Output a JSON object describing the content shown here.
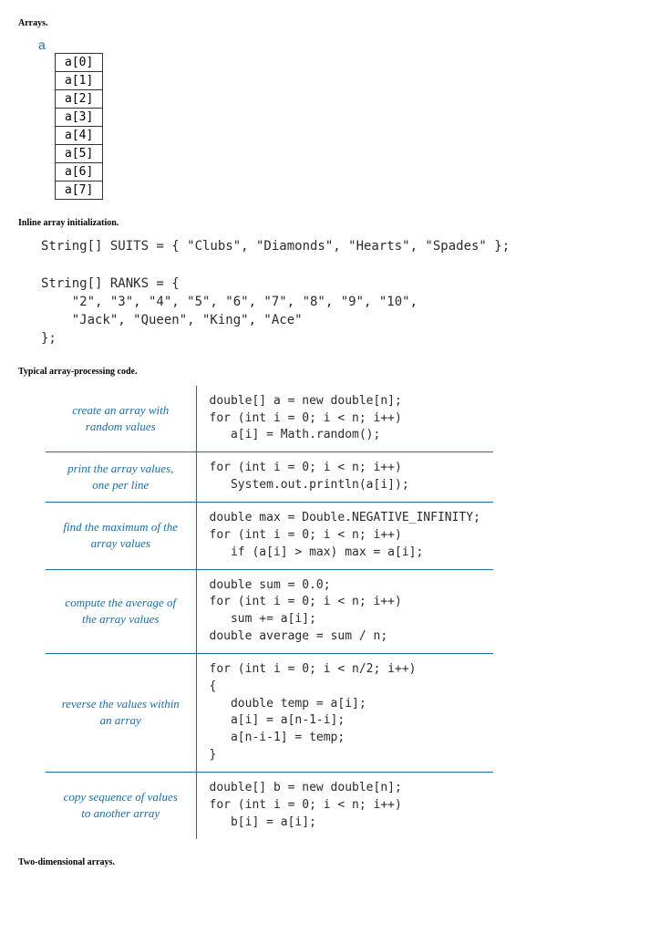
{
  "headings": {
    "arrays": "Arrays.",
    "inline_init": "Inline array initialization.",
    "processing": "Typical array-processing code.",
    "two_d": "Two-dimensional arrays."
  },
  "array_diagram": {
    "label": "a",
    "cells": [
      "a[0]",
      "a[1]",
      "a[2]",
      "a[3]",
      "a[4]",
      "a[5]",
      "a[6]",
      "a[7]"
    ]
  },
  "inline_code": "String[] SUITS = { \"Clubs\", \"Diamonds\", \"Hearts\", \"Spades\" };\n\nString[] RANKS = {\n    \"2\", \"3\", \"4\", \"5\", \"6\", \"7\", \"8\", \"9\", \"10\",\n    \"Jack\", \"Queen\", \"King\", \"Ace\"\n};",
  "processing_rows": [
    {
      "desc": "create an array\nwith random values",
      "code": "double[] a = new double[n];\nfor (int i = 0; i < n; i++)\n   a[i] = Math.random();"
    },
    {
      "desc": "print the array values,\none per line",
      "code": "for (int i = 0; i < n; i++)\n   System.out.println(a[i]);"
    },
    {
      "desc": "find the maximum of\nthe array values",
      "code": "double max = Double.NEGATIVE_INFINITY;\nfor (int i = 0; i < n; i++)\n   if (a[i] > max) max = a[i];"
    },
    {
      "desc": "compute the average of\nthe array values",
      "code": "double sum = 0.0;\nfor (int i = 0; i < n; i++)\n   sum += a[i];\ndouble average = sum / n;"
    },
    {
      "desc": "reverse the values\nwithin an array",
      "code": "for (int i = 0; i < n/2; i++)\n{\n   double temp = a[i];\n   a[i] = a[n-1-i];\n   a[n-i-1] = temp;\n}"
    },
    {
      "desc": "copy sequence of values\nto another array",
      "code": "double[] b = new double[n];\nfor (int i = 0; i < n; i++)\n   b[i] = a[i];"
    }
  ]
}
